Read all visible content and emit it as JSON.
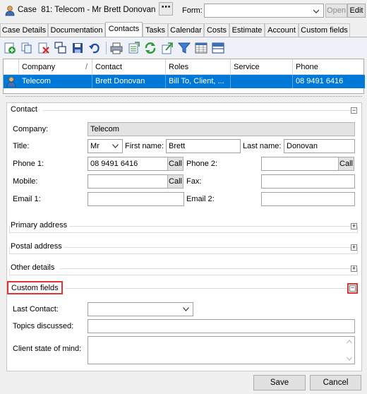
{
  "header": {
    "case_title": "Case  81: Telecom - Mr Brett Donovan",
    "more_button": "⋯",
    "form_label": "Form:",
    "form_value": "",
    "open_label": "Open",
    "edit_label": "Edit"
  },
  "tabs": [
    {
      "label": "Case Details"
    },
    {
      "label": "Documentation"
    },
    {
      "label": "Contacts"
    },
    {
      "label": "Tasks"
    },
    {
      "label": "Calendar"
    },
    {
      "label": "Costs"
    },
    {
      "label": "Estimate"
    },
    {
      "label": "Account"
    },
    {
      "label": "Custom fields"
    }
  ],
  "active_tab": "Contacts",
  "toolbar": [
    "add-contact-icon",
    "copy-icon",
    "delete-icon",
    "duplicate-icon",
    "save-icon",
    "undo-icon",
    "print-icon",
    "export-icon",
    "refresh-icon",
    "import-icon",
    "filter-icon",
    "grid-view-icon",
    "split-view-icon"
  ],
  "grid": {
    "columns": [
      "Company",
      "Contact",
      "Roles",
      "Service",
      "Phone"
    ],
    "rows": [
      {
        "company": "Telecom",
        "contact": "Brett Donovan",
        "roles": "Bill To, Client, ...",
        "service": "",
        "phone": "08 9491 6416"
      }
    ]
  },
  "contact": {
    "section_title": "Contact",
    "company_label": "Company:",
    "company_value": "Telecom",
    "title_label": "Title:",
    "title_value": "Mr",
    "first_name_label": "First name:",
    "first_name_value": "Brett",
    "last_name_label": "Last name:",
    "last_name_value": "Donovan",
    "phone1_label": "Phone 1:",
    "phone1_value": "08 9491 6416",
    "phone2_label": "Phone 2:",
    "phone2_value": "",
    "mobile_label": "Mobile:",
    "mobile_value": "",
    "fax_label": "Fax:",
    "fax_value": "",
    "email1_label": "Email 1:",
    "email1_value": "",
    "email2_label": "Email 2:",
    "email2_value": "",
    "call_label": "Call"
  },
  "sections": {
    "primary_address": "Primary address",
    "postal_address": "Postal address",
    "other_details": "Other details",
    "custom_fields": "Custom fields"
  },
  "custom": {
    "last_contact_label": "Last Contact:",
    "last_contact_value": "",
    "topics_label": "Topics discussed:",
    "topics_value": "",
    "state_label": "Client  state of mind:",
    "state_value": ""
  },
  "footer": {
    "save_label": "Save",
    "cancel_label": "Cancel"
  },
  "colors": {
    "selection": "#0078d7",
    "highlight_border": "#e03535"
  }
}
